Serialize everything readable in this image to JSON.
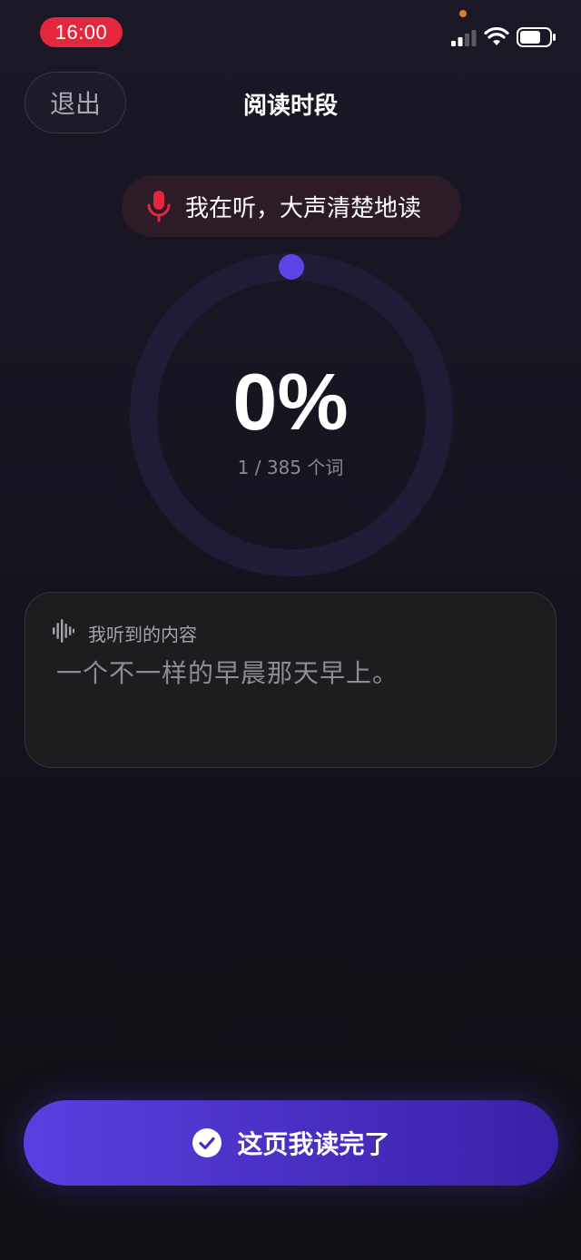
{
  "status_bar": {
    "time": "16:00"
  },
  "header": {
    "exit_label": "退出",
    "title": "阅读时段"
  },
  "listening": {
    "text": "我在听，大声清楚地读"
  },
  "progress": {
    "percent_text": "0%",
    "word_count": "1 / 385 个词",
    "fraction": 0
  },
  "transcript": {
    "label": "我听到的内容",
    "text": "一个不一样的早晨那天早上。"
  },
  "done_button": {
    "label": "这页我读完了"
  },
  "colors": {
    "accent": "#5b3fe0",
    "mic": "#e5273d",
    "ring_track": "#1f1c38"
  }
}
